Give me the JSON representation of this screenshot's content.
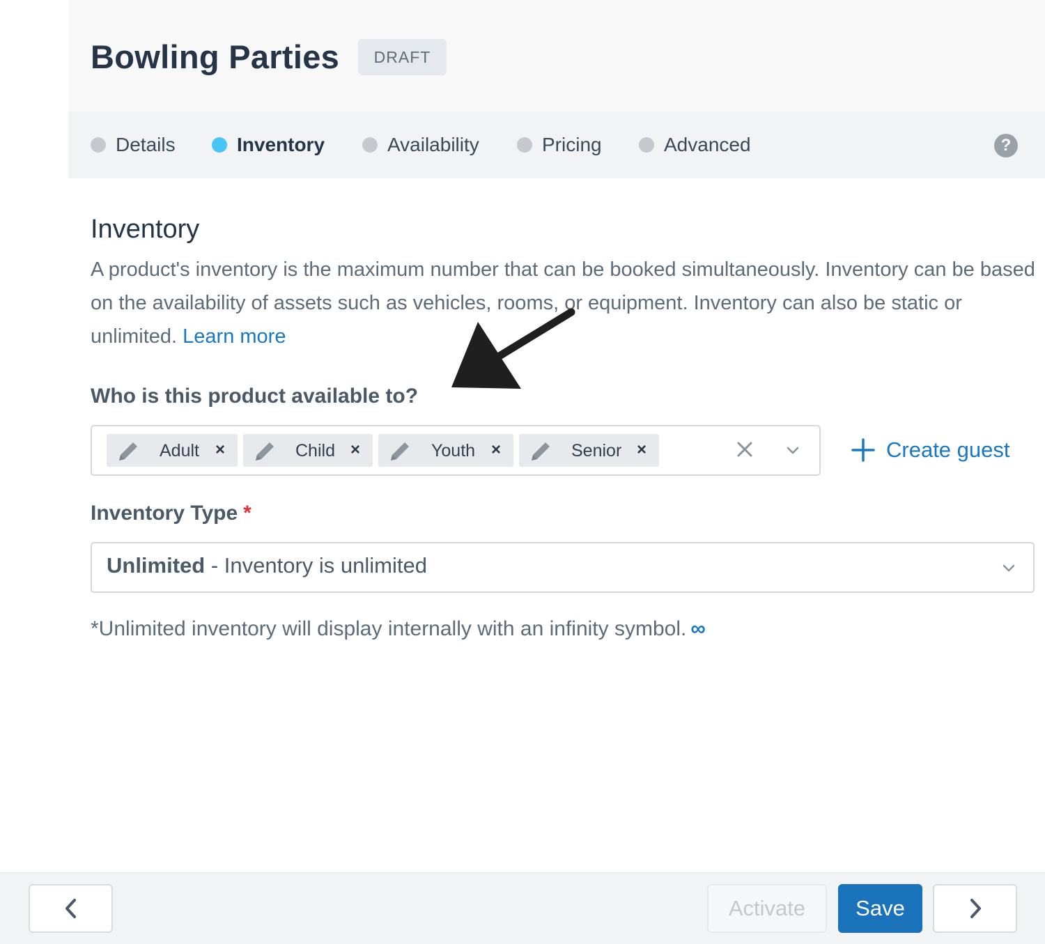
{
  "header": {
    "title": "Bowling Parties",
    "status_badge": "DRAFT"
  },
  "steps": [
    {
      "label": "Details",
      "active": false
    },
    {
      "label": "Inventory",
      "active": true
    },
    {
      "label": "Availability",
      "active": false
    },
    {
      "label": "Pricing",
      "active": false
    },
    {
      "label": "Advanced",
      "active": false
    }
  ],
  "help_glyph": "?",
  "section": {
    "title": "Inventory",
    "description": "A product's inventory is the maximum number that can be booked simultaneously. Inventory can be based on the availability of assets such as vehicles, rooms, or equipment. Inventory can also be static or unlimited. ",
    "learn_more": "Learn more"
  },
  "guests": {
    "label": "Who is this product available to?",
    "tags": [
      "Adult",
      "Child",
      "Youth",
      "Senior"
    ],
    "remove_glyph": "×",
    "create_label": "Create guest"
  },
  "inventory_type": {
    "label": "Inventory Type",
    "required_mark": "*",
    "selected_bold": "Unlimited",
    "selected_rest": " - Inventory is unlimited"
  },
  "footnote": {
    "text": "*Unlimited inventory will display internally with an infinity symbol.",
    "symbol": "∞"
  },
  "footer": {
    "activate_label": "Activate",
    "save_label": "Save"
  },
  "colors": {
    "accent": "#1a78c2",
    "active_step": "#48c4f6",
    "required": "#e0323a"
  }
}
